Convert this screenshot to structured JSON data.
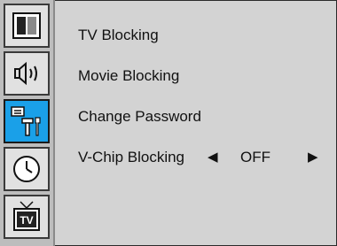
{
  "sidebar": {
    "tabs": [
      {
        "icon": "picture-icon",
        "active": false
      },
      {
        "icon": "sound-icon",
        "active": false
      },
      {
        "icon": "setup-tools-icon",
        "active": true
      },
      {
        "icon": "clock-icon",
        "active": false
      },
      {
        "icon": "tv-icon",
        "active": false,
        "label": "TV"
      }
    ]
  },
  "menu": {
    "items": [
      {
        "label": "TV Blocking"
      },
      {
        "label": "Movie Blocking"
      },
      {
        "label": "Change Password"
      },
      {
        "label": "V-Chip Blocking",
        "value": "OFF",
        "left_arrow": "◀",
        "right_arrow": "▶"
      }
    ]
  },
  "colors": {
    "background": "#d3d3d3",
    "sidebar": "#bdbdbd",
    "active_tab": "#1aa0e8",
    "text": "#111111"
  }
}
